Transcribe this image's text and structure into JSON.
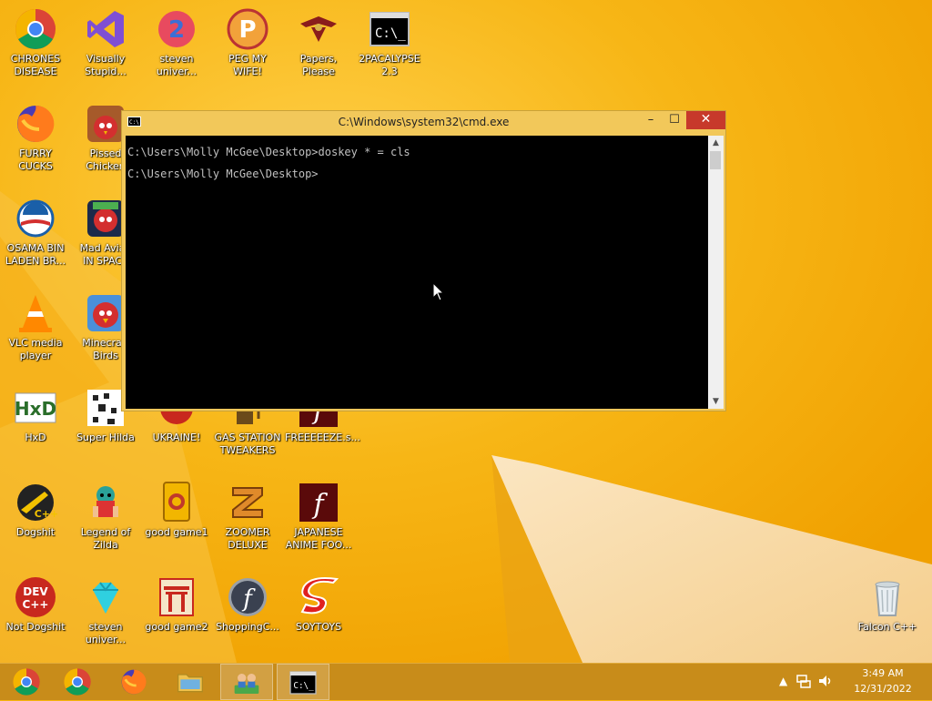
{
  "desktop": {
    "icons": [
      {
        "id": "chrones-disease",
        "label": "CHRONES\nDISEASE",
        "icon": "chrome-icon"
      },
      {
        "id": "visually-stupid",
        "label": "Visually\nStupid...",
        "icon": "visual-studio-icon"
      },
      {
        "id": "steven-univer-1",
        "label": "steven\nuniver...",
        "icon": "steven-universe-icon"
      },
      {
        "id": "peg-my-wife",
        "label": "PEG MY WIFE!",
        "icon": "peggle-icon"
      },
      {
        "id": "papers-please",
        "label": "Papers,\nPlease",
        "icon": "papers-please-icon"
      },
      {
        "id": "2pacalypse",
        "label": "2PACALYPSE\n2.3",
        "icon": "cmd-icon"
      },
      {
        "id": "furry-cucks",
        "label": "FURRY CUCKS",
        "icon": "firefox-icon"
      },
      {
        "id": "pissed-chicken",
        "label": "Pissed\nChicken",
        "icon": "angry-birds-seasons-icon"
      },
      {
        "id": "osama-bin-laden",
        "label": "OSAMA BIN\nLADEN BR...",
        "icon": "obama-logo-icon"
      },
      {
        "id": "mad-avian-in-space",
        "label": "Mad Avian\nIN SPACE",
        "icon": "angry-birds-space-icon"
      },
      {
        "id": "vlc-media-player",
        "label": "VLC media\nplayer",
        "icon": "vlc-icon"
      },
      {
        "id": "minecraft-birds",
        "label": "Minecraft\nBirds",
        "icon": "angry-birds-icon"
      },
      {
        "id": "hxd",
        "label": "HxD",
        "icon": "hxd-icon"
      },
      {
        "id": "super-hilda",
        "label": "Super Hilda",
        "icon": "pixel-art-icon"
      },
      {
        "id": "ukraine",
        "label": "UKRAINE!",
        "icon": "red-circle-icon"
      },
      {
        "id": "gas-station-tweakers",
        "label": "GAS STATION\nTWEAKERS",
        "icon": "gas-station-icon"
      },
      {
        "id": "freeeeze",
        "label": "FREEEEEZE.s...",
        "icon": "flash-icon"
      },
      {
        "id": "dogshit",
        "label": "Dogshit",
        "icon": "codeblocks-icon"
      },
      {
        "id": "legend-of-zilda",
        "label": "Legend of\nZilda",
        "icon": "zelda-icon"
      },
      {
        "id": "good-game1",
        "label": "good game1",
        "icon": "mahjong-icon"
      },
      {
        "id": "zoomer-deluxe",
        "label": "ZOOMER\nDELUXE",
        "icon": "zuma-icon"
      },
      {
        "id": "japanese-anime",
        "label": "JAPANESE\nANIME FOO...",
        "icon": "flash-icon"
      },
      {
        "id": "not-dogshit",
        "label": "Not Dogshit",
        "icon": "dev-cpp-icon"
      },
      {
        "id": "steven-univer-2",
        "label": "steven\nuniver...",
        "icon": "diamond-icon"
      },
      {
        "id": "good-game2",
        "label": "good game2",
        "icon": "torii-icon"
      },
      {
        "id": "shopping-c",
        "label": "ShoppingC...",
        "icon": "flash-circle-icon"
      },
      {
        "id": "soytoys",
        "label": "SOYTOYS",
        "icon": "sonic-s-icon"
      },
      {
        "id": "falcon-cpp",
        "label": "Falcon C++",
        "icon": "recycle-bin-icon"
      }
    ]
  },
  "cmd": {
    "title": "C:\\Windows\\system32\\cmd.exe",
    "icon_text": "C:\\.",
    "lines": [
      "C:\\Users\\Molly McGee\\Desktop>doskey * = cls",
      "",
      "C:\\Users\\Molly McGee\\Desktop>"
    ],
    "minimize": "–",
    "maximize": "☐",
    "close": "✕"
  },
  "taskbar": {
    "apps": [
      {
        "id": "taskbar-app-1",
        "icon": "chrome-dark-icon",
        "active": false
      },
      {
        "id": "taskbar-chrome",
        "icon": "chrome-icon",
        "active": false
      },
      {
        "id": "taskbar-firefox",
        "icon": "firefox-icon",
        "active": false
      },
      {
        "id": "taskbar-file-explorer",
        "icon": "folder-icon",
        "active": false
      },
      {
        "id": "taskbar-network",
        "icon": "network-users-icon",
        "active": true
      },
      {
        "id": "taskbar-cmd",
        "icon": "cmd-icon",
        "active": true
      }
    ],
    "clock": {
      "time": "3:49 AM",
      "date": "12/31/2022"
    }
  }
}
